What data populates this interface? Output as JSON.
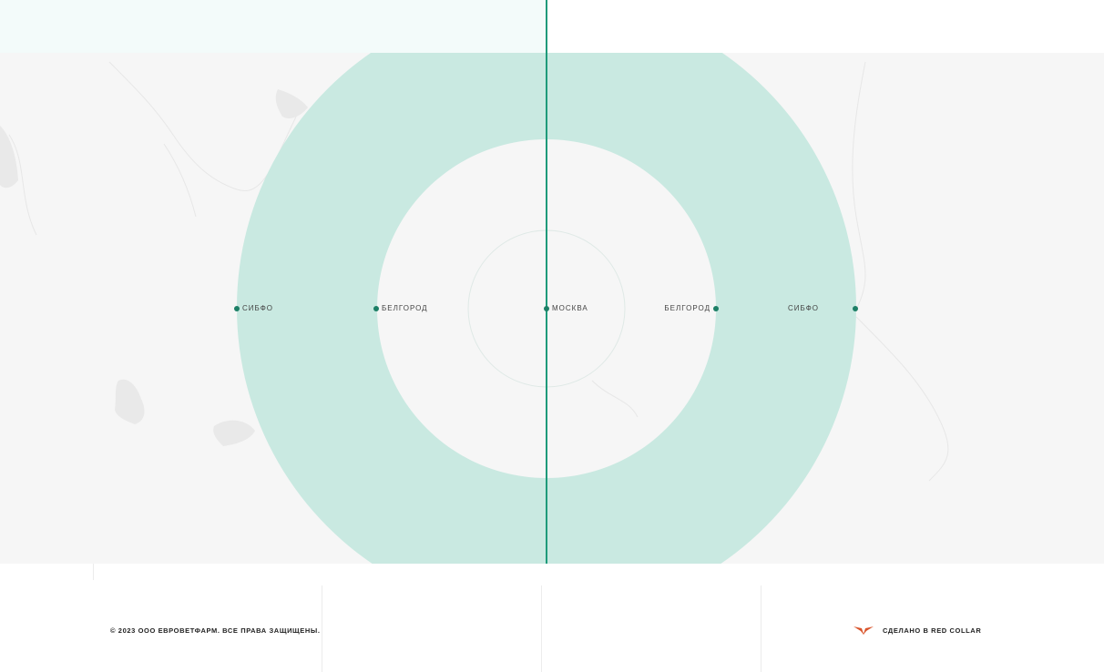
{
  "colors": {
    "accent": "#1f9a7a",
    "marker": "#1d7f66",
    "ring": "#c9e9e1",
    "map_background": "#f6f6f6",
    "top_band": "#f3fbfa",
    "brand_logo": "#d9542b"
  },
  "map": {
    "labels": {
      "left_outer": "СИБФО",
      "left_inner": "БЕЛГОРОД",
      "center": "МОСКВА",
      "right_inner": "БЕЛГОРОД",
      "right_outer": "СИБФО"
    }
  },
  "footer": {
    "copyright": "© 2023 ООО ЕВРОВЕТФАРМ. ВСЕ ПРАВА ЗАЩИЩЕНЫ.",
    "made_by": "СДЕЛАНО В RED COLLAR",
    "made_by_icon": "red-collar-logo-icon"
  }
}
